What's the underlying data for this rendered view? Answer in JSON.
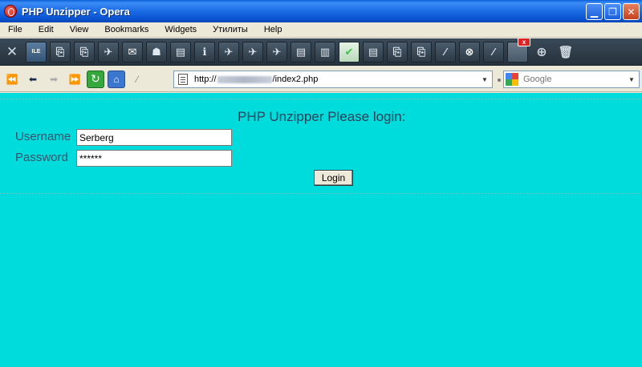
{
  "window": {
    "title": "PHP Unzipper - Opera"
  },
  "menu": [
    "File",
    "Edit",
    "View",
    "Bookmarks",
    "Widgets",
    "Утилиты",
    "Help"
  ],
  "panel_toolbar": {
    "icons": [
      "tools-icon",
      "ile-icon",
      "bookmark-icon",
      "bookmark-icon",
      "plane-icon",
      "mail-icon",
      "person-icon",
      "document-icon",
      "info-icon",
      "plane-icon",
      "plane-icon",
      "plane-icon",
      "document-icon",
      "document-icon",
      "checkmark-icon",
      "document-icon",
      "bookmark-icon",
      "bookmark-icon",
      "wand-icon",
      "globe-icon",
      "wand-icon",
      "active-tab-icon",
      "plus-icon",
      "trash-icon"
    ],
    "ile_label": "ILE",
    "close_label": "x"
  },
  "navigation": {
    "address_prefix": "http://",
    "address_suffix": "/index2.php",
    "search_placeholder": "Google"
  },
  "page": {
    "title": "PHP Unzipper Please login:",
    "username_label": "Username",
    "username_value": "Serberg",
    "password_label": "Password",
    "password_value": "******",
    "login_button": "Login"
  },
  "colors": {
    "page_background": "#00dcdc",
    "titlebar": "#0b56d4",
    "label_text": "#39506a"
  }
}
